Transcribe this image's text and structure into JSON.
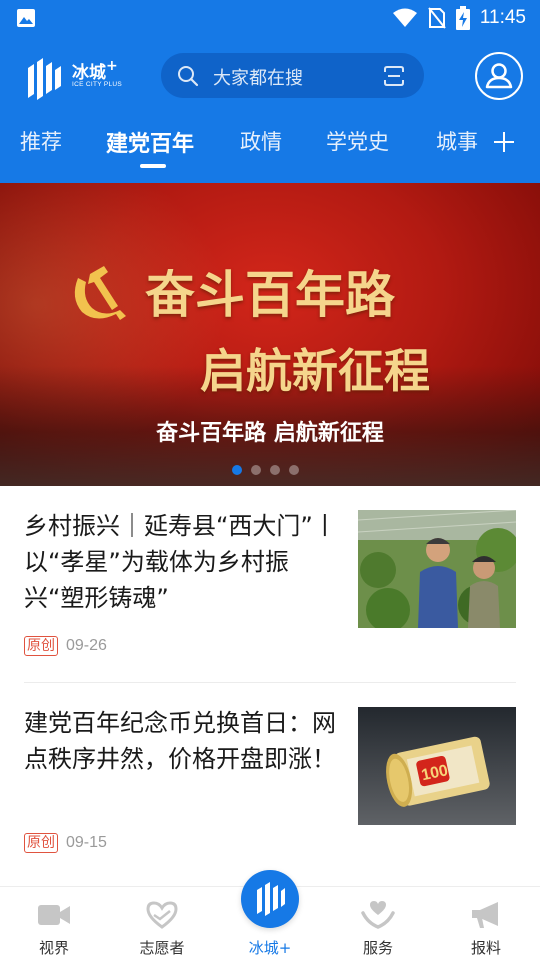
{
  "status_bar": {
    "time": "11:45"
  },
  "header": {
    "logo": {
      "name": "冰城",
      "plus": "+",
      "sub": "ICE CITY PLUS"
    },
    "search": {
      "placeholder": "大家都在搜"
    }
  },
  "tabs": [
    {
      "label": "推荐"
    },
    {
      "label": "建党百年"
    },
    {
      "label": "政情"
    },
    {
      "label": "学党史"
    },
    {
      "label": "城事"
    }
  ],
  "banner": {
    "slogan_line1": "奋斗百年路",
    "slogan_line2": "启航新征程",
    "caption": "奋斗百年路 启航新征程",
    "slide_count": 4,
    "active_slide": 1
  },
  "news": [
    {
      "title": "乡村振兴｜延寿县“西大门”丨以“孝星”为载体为乡村振兴“塑形铸魂”",
      "badge": "原创",
      "date": "09-26"
    },
    {
      "title": "建党百年纪念币兑换首日：网点秩序井然，价格开盘即涨！",
      "badge": "原创",
      "date": "09-15"
    }
  ],
  "bottom_nav": [
    {
      "label": "视界",
      "icon": "video-icon"
    },
    {
      "label": "志愿者",
      "icon": "heart-hands-icon"
    },
    {
      "label": "冰城+",
      "icon": "ice-city-logo-icon"
    },
    {
      "label": "服务",
      "icon": "service-hands-icon"
    },
    {
      "label": "报料",
      "icon": "megaphone-icon"
    }
  ],
  "colors": {
    "primary": "#1679e6",
    "banner_red": "#b21a12",
    "badge_red": "#e0533f"
  }
}
